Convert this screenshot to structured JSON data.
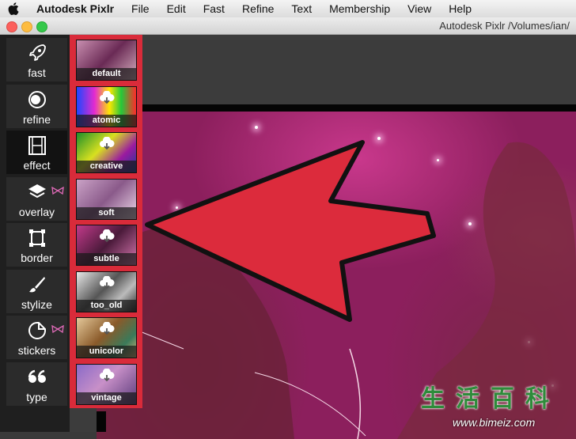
{
  "menubar": {
    "app_name": "Autodesk Pixlr",
    "menus": [
      "File",
      "Edit",
      "Fast",
      "Refine",
      "Text",
      "Membership",
      "View",
      "Help"
    ]
  },
  "window": {
    "title": "Autodesk Pixlr  /Volumes/ian/"
  },
  "sidebar": {
    "tools": [
      {
        "label": "fast",
        "icon": "rocket-icon"
      },
      {
        "label": "refine",
        "icon": "overlapping-circles-icon"
      },
      {
        "label": "effect",
        "icon": "film-strip-icon",
        "active": true
      },
      {
        "label": "overlay",
        "icon": "layers-icon",
        "badge": "bow-icon"
      },
      {
        "label": "border",
        "icon": "frame-icon"
      },
      {
        "label": "stylize",
        "icon": "brush-icon"
      },
      {
        "label": "stickers",
        "icon": "sticker-icon",
        "badge": "bow-icon"
      },
      {
        "label": "type",
        "icon": "quote-icon"
      }
    ]
  },
  "effects": {
    "items": [
      {
        "label": "default",
        "download": false
      },
      {
        "label": "atomic",
        "download": true
      },
      {
        "label": "creative",
        "download": true
      },
      {
        "label": "soft",
        "download": false
      },
      {
        "label": "subtle",
        "download": true
      },
      {
        "label": "too_old",
        "download": true
      },
      {
        "label": "unicolor",
        "download": true
      },
      {
        "label": "vintage",
        "download": true
      }
    ]
  },
  "watermark": {
    "chars": [
      "生",
      "活",
      "百",
      "科"
    ],
    "url": "www.bimeiz.com"
  },
  "colors": {
    "highlight": "#d92b3a",
    "arrow": "#dc2b3c",
    "sidebar_bg": "#1f1f1f"
  }
}
